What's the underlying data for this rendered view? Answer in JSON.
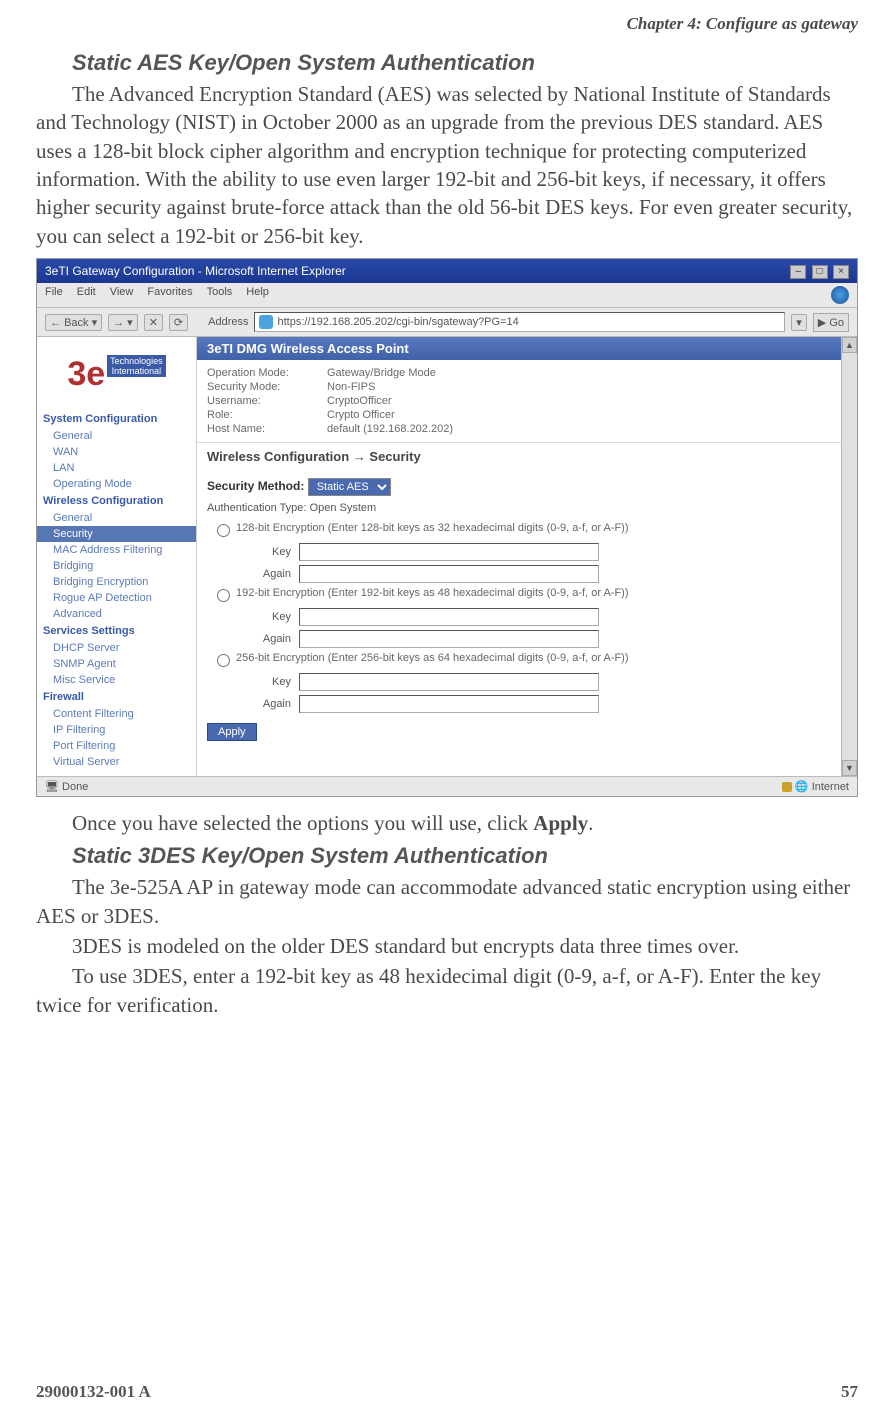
{
  "header": "Chapter 4: Configure as gateway",
  "section1_title": "Static AES Key/Open System Authentication",
  "para1": "The Advanced Encryption Standard (AES) was selected by National Institute of Standards and Technology (NIST) in October 2000 as an upgrade from the previous DES standard.  AES uses a 128-bit block cipher algorithm and encryption technique for protecting computerized information.  With the ability to use even larger 192-bit and 256-bit keys, if necessary, it offers higher security against brute-force attack than the old 56-bit DES keys.  For even greater security, you can select a 192-bit or 256-bit key.",
  "para2_a": "Once you have selected the options you will use, click ",
  "para2_b": "Apply",
  "para2_c": ".",
  "section2_title": "Static 3DES Key/Open System Authentication",
  "para3": "The 3e-525A AP in gateway mode can accommodate advanced static encryption using either AES or 3DES.",
  "para4": "3DES is modeled on the older DES standard but encrypts data three times over.",
  "para5": "To use 3DES, enter a 192-bit key as 48 hexidecimal digit (0-9, a-f, or A-F). Enter the key twice for verification.",
  "footer_left": "29000132-001 A",
  "footer_right": "57",
  "shot": {
    "title": "3eTI Gateway Configuration - Microsoft Internet Explorer",
    "menu": [
      "File",
      "Edit",
      "View",
      "Favorites",
      "Tools",
      "Help"
    ],
    "back": "Back",
    "address_label": "Address",
    "url": "https://192.168.205.202/cgi-bin/sgateway?PG=14",
    "go": "Go",
    "banner": "3eTI DMG Wireless Access Point",
    "info": {
      "op_mode_lbl": "Operation Mode:",
      "op_mode_val": "Gateway/Bridge Mode",
      "sec_mode_lbl": "Security Mode:",
      "sec_mode_val": "Non-FIPS",
      "user_lbl": "Username:",
      "user_val": "CryptoOfficer",
      "role_lbl": "Role:",
      "role_val": "Crypto Officer",
      "host_lbl": "Host Name:",
      "host_val": "default (192.168.202.202)"
    },
    "breadcrumb": "Wireless Configuration → Security",
    "sec_method_lbl": "Security Method:",
    "sec_method_val": "Static AES",
    "auth_type": "Authentication Type: Open System",
    "radio128": "128-bit Encryption (Enter 128-bit keys as 32 hexadecimal digits (0-9, a-f, or A-F))",
    "radio192": "192-bit Encryption (Enter 192-bit keys as 48 hexadecimal digits (0-9, a-f, or A-F))",
    "radio256": "256-bit Encryption (Enter 256-bit keys as 64 hexadecimal digits (0-9, a-f, or A-F))",
    "key_lbl": "Key",
    "again_lbl": "Again",
    "apply": "Apply",
    "status_left": "Done",
    "status_right": "Internet",
    "nav": {
      "s1": "System Configuration",
      "s1_items": [
        "General",
        "WAN",
        "LAN",
        "Operating Mode"
      ],
      "s2": "Wireless Configuration",
      "s2_items": [
        "General",
        "Security",
        "MAC Address Filtering",
        "Bridging",
        "Bridging Encryption",
        "Rogue AP Detection",
        "Advanced"
      ],
      "s3": "Services Settings",
      "s3_items": [
        "DHCP Server",
        "SNMP Agent",
        "Misc Service"
      ],
      "s4": "Firewall",
      "s4_items": [
        "Content Filtering",
        "IP Filtering",
        "Port Filtering",
        "Virtual Server"
      ]
    }
  }
}
